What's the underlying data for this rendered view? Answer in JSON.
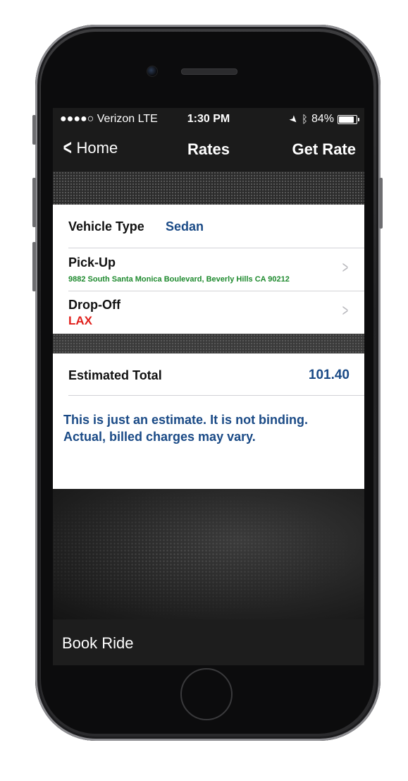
{
  "status_bar": {
    "carrier": "●●●●○ Verizon  LTE",
    "time": "1:30 PM",
    "battery": "84%"
  },
  "nav": {
    "back_label": "Home",
    "title": "Rates",
    "right_action": "Get Rate"
  },
  "form": {
    "vehicle_type_label": "Vehicle Type",
    "vehicle_type_value": "Sedan",
    "pickup_label": "Pick-Up",
    "pickup_address": "9882 South Santa Monica Boulevard, Beverly Hills CA 90212",
    "dropoff_label": "Drop-Off",
    "dropoff_value": "LAX"
  },
  "estimate": {
    "label": "Estimated Total",
    "value": "101.40",
    "disclaimer": "This is just an estimate.  It is not binding. Actual, billed charges may vary."
  },
  "bottom": {
    "book_label": "Book Ride"
  },
  "colors": {
    "accent_blue": "#1a4a86",
    "pickup_green": "#1e8a2e",
    "dropoff_red": "#e0201c"
  }
}
